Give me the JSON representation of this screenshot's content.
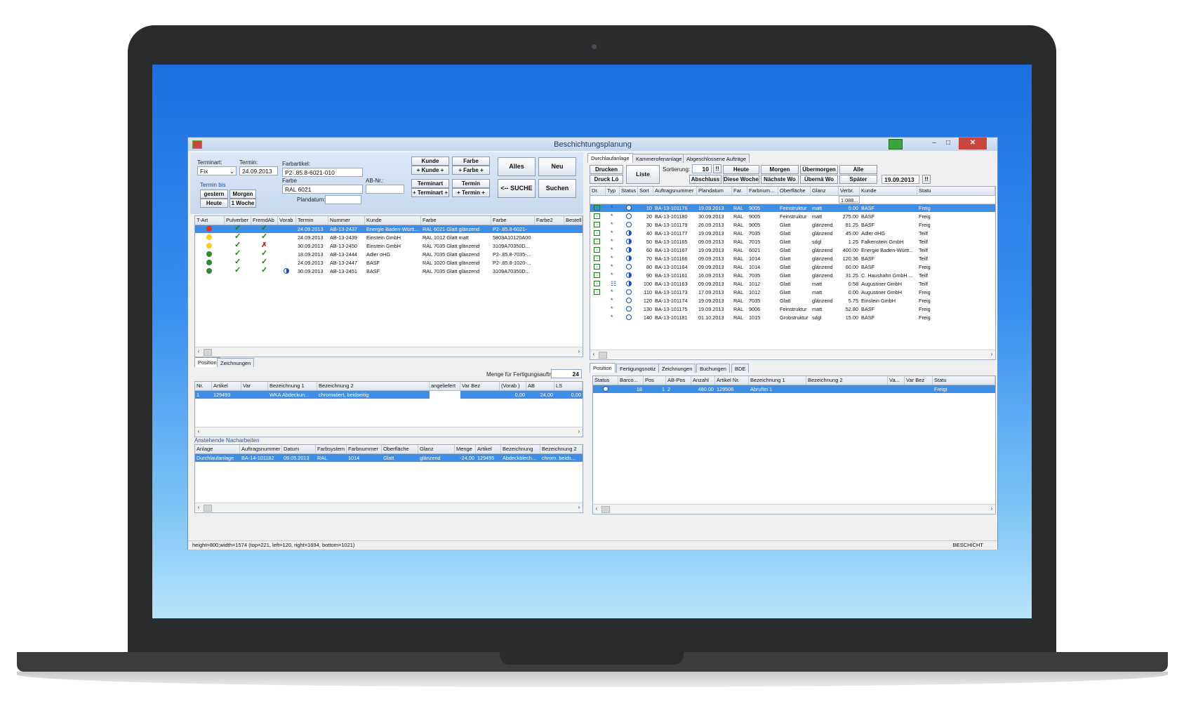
{
  "window": {
    "title": "Beschichtungsplanung"
  },
  "filter": {
    "terminart_label": "Terminart:",
    "terminart_value": "Fix",
    "termin_label": "Termin:",
    "termin_value": "24.09.2013",
    "farbartikel_label": "Farbartikel:",
    "farbartikel_value": "P2-.85.8-6021-010",
    "farbe_label": "Farbe",
    "farbe_value": "RAL 6021",
    "abnr_label": "AB-Nr.:",
    "abnr_value": "",
    "termin_bis_label": "Termin bis",
    "plandatum_label": "Plandatum:",
    "plandatum_value": "",
    "btn_gestern": "gestern",
    "btn_morgen": "Morgen",
    "btn_heute": "Heute",
    "btn_1woche": "1 Woche",
    "btn_kunde": "Kunde",
    "btn_kunde_plus": "+ Kunde +",
    "btn_farbe": "Farbe",
    "btn_farbe_plus": "+ Farbe +",
    "btn_terminart": "Terminart",
    "btn_terminart_plus": "+ Terminart +",
    "btn_termin": "Termin",
    "btn_termin_plus": "+ Termin +",
    "btn_alles": "Alles",
    "btn_neu": "Neu",
    "btn_suche": "<-- SUCHE",
    "btn_suchen": "Suchen"
  },
  "main_grid": {
    "headers": [
      "T-Art",
      "Pulverber",
      "FremdAb",
      "Vorab",
      "Termin",
      "Nummer",
      "Kunde",
      "Farbe",
      "Farbe",
      "Farbe2",
      "Bestell N"
    ],
    "rows": [
      {
        "dot": "#d93a2b",
        "puls": "check",
        "fremd": "check",
        "vorab": "",
        "termin": "24.09.2013",
        "nummer": "AB-13-2437",
        "kunde": "Energie Baden-Württ...",
        "farbe": "RAL 6021 Glatt glänzend",
        "farbe_code": "P2-.85.8-6021-",
        "sel": true
      },
      {
        "dot": "#f2cf1f",
        "puls": "check",
        "fremd": "check",
        "vorab": "",
        "termin": "24.09.2013",
        "nummer": "AB-13-2439",
        "kunde": "Einstein GmbH",
        "farbe": "RAL 1012 Glatt matt",
        "farbe_code": "5803A10120A00",
        "sel": false
      },
      {
        "dot": "#f2cf1f",
        "puls": "check",
        "fremd": "cross",
        "vorab": "",
        "termin": "30.09.2013",
        "nummer": "AB-13-2450",
        "kunde": "Einstein GmbH",
        "farbe": "RAL 7035 Glatt glänzend",
        "farbe_code": "3109A70350D...",
        "sel": false
      },
      {
        "dot": "#2e8b2e",
        "puls": "check",
        "fremd": "check",
        "vorab": "",
        "termin": "18.09.2013",
        "nummer": "AB-13-2444",
        "kunde": "Adler oHG",
        "farbe": "RAL 7035 Glatt glänzend",
        "farbe_code": "P2-.85.8-7035-...",
        "sel": false
      },
      {
        "dot": "#2e8b2e",
        "puls": "check",
        "fremd": "check",
        "vorab": "",
        "termin": "24.09.2013",
        "nummer": "AB-13-2447",
        "kunde": "BASF",
        "farbe": "RAL 1020 Glatt glänzend",
        "farbe_code": "P2-.85.8-1020-...",
        "sel": false
      },
      {
        "dot": "#2e8b2e",
        "puls": "check",
        "fremd": "check",
        "vorab": "half",
        "termin": "30.09.2013",
        "nummer": "AB-13-2451",
        "kunde": "BASF",
        "farbe": "RAL 7035 Glatt glänzend",
        "farbe_code": "3109A70350D...",
        "sel": false
      }
    ]
  },
  "pos_tabs": [
    "Position",
    "Zeichnungen"
  ],
  "pos": {
    "menge_label": "Menge für Fertigungsauftrag",
    "menge_value": "24",
    "headers": [
      "Nr.",
      "Artikel",
      "Var",
      "Bezeichnung 1",
      "Bezeichnung 2",
      "angeliefert",
      "Var Bez",
      "(Vorab )",
      "AB",
      "LS"
    ],
    "rows": [
      [
        "1",
        "129493",
        "",
        "WKA Abdeckun...",
        "chromatiert, beidseitig",
        "",
        "",
        "0,00",
        "24,00",
        "0,00"
      ]
    ]
  },
  "nach": {
    "title": "Anstehende Nacharbeiten",
    "headers": [
      "Anlage",
      "Auftragsnummer",
      "Datum",
      "Farbsystem",
      "Farbnummer",
      "Oberfläche",
      "Glanz",
      "Menge",
      "Artikel",
      "Bezeichnung",
      "Bezeichnung 2"
    ],
    "rows": [
      [
        "Durchlaufanlage",
        "BA-14-101182",
        "09.05.2013",
        "RAL",
        "1014",
        "Glatt",
        "glänzend",
        "-24,00",
        "129495",
        "Abdeckblech...",
        "chrom. beids..."
      ]
    ]
  },
  "right_tabs": [
    "Durchlaufanlage",
    "Kammerofenanlage",
    "Abgeschlossene Aufträge"
  ],
  "right_toolbar": {
    "drucken": "Drucken",
    "druck_lo": "Druck Lö",
    "liste": "Liste",
    "sortierung_label": "Sortierung:",
    "sortierung_value": "10",
    "heute": "Heute",
    "morgen": "Morgen",
    "uebermorgen": "Übermorgen",
    "alle": "Alle",
    "abschluss": "Abschluss",
    "diese_woche": "Diese Woche",
    "naechste_wo": "Nächste Wo",
    "uebernae_wo": "Übernä Wo",
    "spaeter": "Später",
    "date_value": "19.09.2013",
    "filter_sum": "1.088..."
  },
  "right_grid": {
    "headers": [
      "Dr.",
      "Typ",
      "Status",
      "Sort",
      "Auftragsnummer",
      "Plandatum",
      "Far.",
      "Farbnum...",
      "Oberfläche",
      "Glanz",
      "Verbr.",
      "Kunde",
      "Statu"
    ],
    "rows": [
      {
        "dr": "g",
        "typ": "*",
        "st": "open",
        "sort": "10",
        "auftrag": "BA-13-101176",
        "plan": "19.09.2013",
        "far": "RAL",
        "farbnum": "9005",
        "ober": "Feinstruktur",
        "glanz": "matt",
        "verbr": "0.00",
        "kunde": "BASF",
        "status": "Freig",
        "sel": true
      },
      {
        "dr": "g",
        "typ": "*",
        "st": "open",
        "sort": "20",
        "auftrag": "BA-13-101180",
        "plan": "30.09.2013",
        "far": "RAL",
        "farbnum": "9005",
        "ober": "Feinstruktur",
        "glanz": "matt",
        "verbr": "275.00",
        "kunde": "BASF",
        "status": "Freig",
        "sel": false
      },
      {
        "dr": "g",
        "typ": "*",
        "st": "open",
        "sort": "30",
        "auftrag": "BA-13-101179",
        "plan": "26.09.2013",
        "far": "RAL",
        "farbnum": "9005",
        "ober": "Glatt",
        "glanz": "glänzend",
        "verbr": "81.25",
        "kunde": "BASF",
        "status": "Freig",
        "sel": false
      },
      {
        "dr": "g",
        "typ": "*",
        "st": "half",
        "sort": "40",
        "auftrag": "BA-13-101177",
        "plan": "19.09.2013",
        "far": "RAL",
        "farbnum": "7035",
        "ober": "Glatt",
        "glanz": "glänzend",
        "verbr": "45.00",
        "kunde": "Adler oHG",
        "status": "Teilf",
        "sel": false
      },
      {
        "dr": "g",
        "typ": "*",
        "st": "half",
        "sort": "50",
        "auftrag": "BA-13-101165",
        "plan": "09.09.2013",
        "far": "RAL",
        "farbnum": "7015",
        "ober": "Glatt",
        "glanz": "sdgl",
        "verbr": "1.25",
        "kunde": "Falkenstein GmbH",
        "status": "Teilf",
        "sel": false
      },
      {
        "dr": "g",
        "typ": "*",
        "st": "half",
        "sort": "60",
        "auftrag": "BA-13-101167",
        "plan": "19.09.2013",
        "far": "RAL",
        "farbnum": "6021",
        "ober": "Glatt",
        "glanz": "glänzend",
        "verbr": "400.00",
        "kunde": "Energie Baden-Württ...",
        "status": "Teilf",
        "sel": false
      },
      {
        "dr": "g",
        "typ": "*",
        "st": "half",
        "sort": "70",
        "auftrag": "BA-13-101166",
        "plan": "09.09.2013",
        "far": "RAL",
        "farbnum": "1014",
        "ober": "Glatt",
        "glanz": "glänzend",
        "verbr": "120.36",
        "kunde": "BASF",
        "status": "Teilf",
        "sel": false
      },
      {
        "dr": "g",
        "typ": "*",
        "st": "open",
        "sort": "80",
        "auftrag": "BA-13-101164",
        "plan": "09.09.2013",
        "far": "RAL",
        "farbnum": "1014",
        "ober": "Glatt",
        "glanz": "glänzend",
        "verbr": "60.00",
        "kunde": "BASF",
        "status": "Freig",
        "sel": false
      },
      {
        "dr": "g",
        "typ": "*",
        "st": "half",
        "sort": "90",
        "auftrag": "BA-13-101161",
        "plan": "16.09.2013",
        "far": "RAL",
        "farbnum": "7035",
        "ober": "Glatt",
        "glanz": "glänzend",
        "verbr": "31.25",
        "kunde": "C. Haushahn GmbH ...",
        "status": "Teilf",
        "sel": false
      },
      {
        "dr": "g",
        "typ": "z",
        "st": "half",
        "sort": "100",
        "auftrag": "BA-13-101163",
        "plan": "09.09.2013",
        "far": "RAL",
        "farbnum": "1012",
        "ober": "Glatt",
        "glanz": "matt",
        "verbr": "0.58",
        "kunde": "Augustiner GmbH",
        "status": "Teilf",
        "sel": false
      },
      {
        "dr": "g",
        "typ": "*",
        "st": "open",
        "sort": "110",
        "auftrag": "BA-13-101173",
        "plan": "17.09.2013",
        "far": "RAL",
        "farbnum": "1012",
        "ober": "Glatt",
        "glanz": "matt",
        "verbr": "0.00",
        "kunde": "Augustiner GmbH",
        "status": "Freig",
        "sel": false
      },
      {
        "dr": "",
        "typ": "*",
        "st": "open",
        "sort": "120",
        "auftrag": "BA-13-101174",
        "plan": "19.09.2013",
        "far": "RAL",
        "farbnum": "7035",
        "ober": "Glatt",
        "glanz": "glänzend",
        "verbr": "5.75",
        "kunde": "Einstein GmbH",
        "status": "Freig",
        "sel": false
      },
      {
        "dr": "",
        "typ": "*",
        "st": "open",
        "sort": "130",
        "auftrag": "BA-13-101175",
        "plan": "19.09.2013",
        "far": "RAL",
        "farbnum": "9006",
        "ober": "Feinstruktur",
        "glanz": "matt",
        "verbr": "52.80",
        "kunde": "BASF",
        "status": "Freig",
        "sel": false
      },
      {
        "dr": "",
        "typ": "*",
        "st": "open",
        "sort": "140",
        "auftrag": "BA-13-101181",
        "plan": "01.10.2013",
        "far": "RAL",
        "farbnum": "1015",
        "ober": "Grobstruktur",
        "glanz": "sdgl",
        "verbr": "15.00",
        "kunde": "BASF",
        "status": "Freig",
        "sel": false
      }
    ]
  },
  "bottom_tabs": [
    "Position",
    "Fertigungsnotiz",
    "Zeichnungen",
    "Buchungen",
    "BDE"
  ],
  "bottom_grid": {
    "headers": [
      "Status",
      "Barco...",
      "Pos",
      "AB-Pos",
      "Anzahl",
      "Artikel Nr.",
      "Bezeichnung 1",
      "Bezeichnung 2",
      "Va...",
      "Var Bez",
      "Statu"
    ],
    "rows": [
      [
        "",
        "18",
        "1",
        "2",
        "480.00",
        "129506",
        "Abruftei 1",
        "",
        "",
        "",
        "Freigt"
      ]
    ]
  },
  "statusbar": {
    "left": "height=800;width=1574 (top=221, left=120, right=1694, bottom=1021)",
    "right": "BESCHICHT"
  }
}
